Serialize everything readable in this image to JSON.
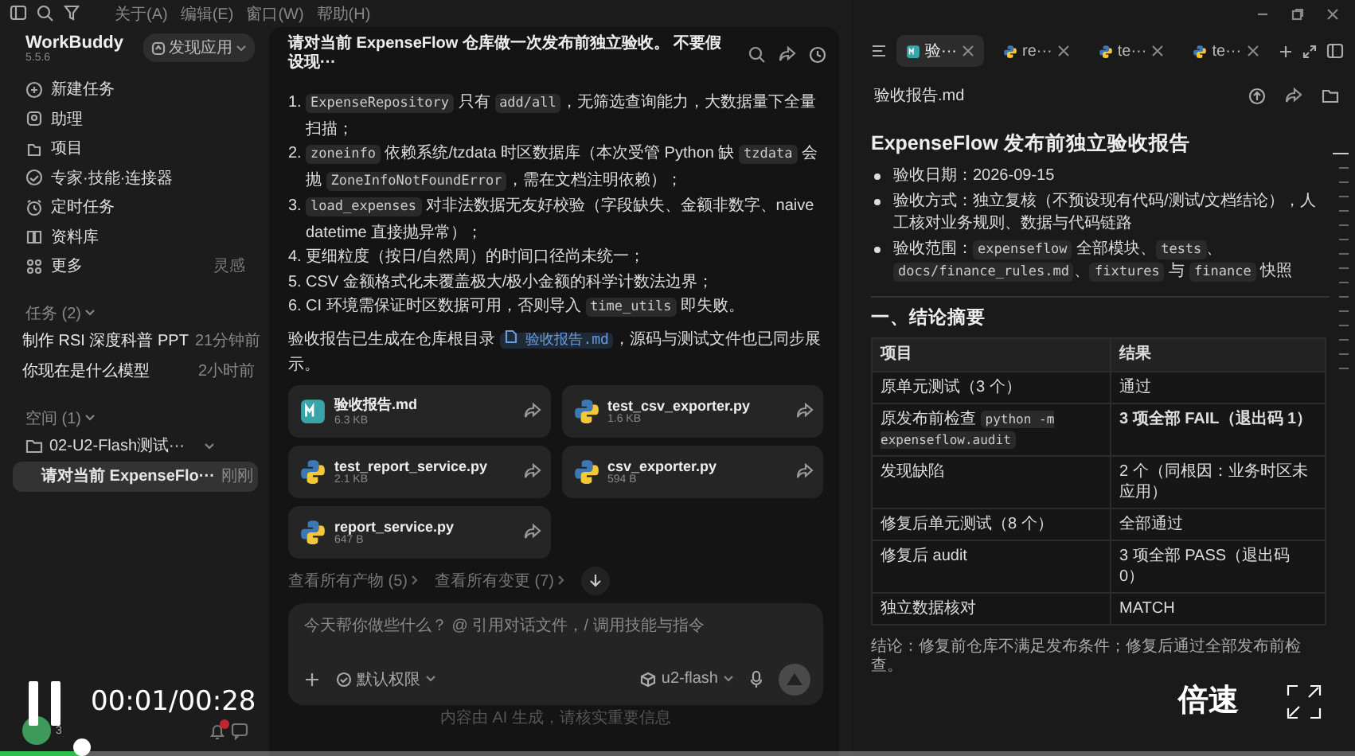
{
  "menu_bar": {
    "items": [
      "关于(A)",
      "编辑(E)",
      "窗口(W)",
      "帮助(H)"
    ]
  },
  "sidebar": {
    "app_name": "WorkBuddy",
    "version": "5.5.6",
    "discover_button": "发现应用",
    "nav": [
      {
        "label": "新建任务"
      },
      {
        "label": "助理"
      },
      {
        "label": "项目"
      },
      {
        "label": "专家·技能·连接器"
      },
      {
        "label": "定时任务"
      },
      {
        "label": "资料库"
      },
      {
        "label": "更多",
        "hint": "灵感"
      }
    ],
    "tasks_header": "任务 (2)",
    "tasks": [
      {
        "title": "制作 RSI 深度科普 PPT",
        "time": "21分钟前",
        "selected": false
      },
      {
        "title": "你现在是什么模型",
        "time": "2小时前",
        "selected": false
      }
    ],
    "spaces_header": "空间 (1)",
    "spaces": [
      {
        "name": "02-U2-Flash测试···",
        "expanded": true,
        "children": [
          {
            "title": "请对当前 ExpenseFlo···",
            "time": "刚刚",
            "selected": true
          }
        ]
      }
    ],
    "avatar_count": "3",
    "notification_dot": true
  },
  "chat": {
    "title": "请对当前 ExpenseFlow 仓库做一次发布前独立验收。 不要假设现···",
    "list": [
      {
        "number": "1.",
        "segments": [
          {
            "kind": "code",
            "text": "ExpenseRepository"
          },
          {
            "kind": "text",
            "text": " 只有 "
          },
          {
            "kind": "code",
            "text": "add/all"
          },
          {
            "kind": "text",
            "text": "，无筛选查询能力，大数据量下全量扫描；"
          }
        ]
      },
      {
        "number": "2.",
        "segments": [
          {
            "kind": "code",
            "text": "zoneinfo"
          },
          {
            "kind": "text",
            "text": " 依赖系统/tzdata 时区数据库（本次受管 Python 缺 "
          },
          {
            "kind": "code",
            "text": "tzdata"
          },
          {
            "kind": "text",
            "text": " 会抛 "
          },
          {
            "kind": "code",
            "text": "ZoneInfoNotFoundError"
          },
          {
            "kind": "text",
            "text": "，需在文档注明依赖）；"
          }
        ]
      },
      {
        "number": "3.",
        "segments": [
          {
            "kind": "code",
            "text": "load_expenses"
          },
          {
            "kind": "text",
            "text": " 对非法数据无友好校验（字段缺失、金额非数字、naive datetime 直接抛异常）；"
          }
        ]
      },
      {
        "number": "4.",
        "segments": [
          {
            "kind": "text",
            "text": "更细粒度（按日/自然周）的时间口径尚未统一；"
          }
        ]
      },
      {
        "number": "5.",
        "segments": [
          {
            "kind": "text",
            "text": "CSV 金额格式化未覆盖极大/极小金额的科学计数法边界；"
          }
        ]
      },
      {
        "number": "6.",
        "segments": [
          {
            "kind": "text",
            "text": "CI 环境需保证时区数据可用，否则导入 "
          },
          {
            "kind": "code",
            "text": "time_utils"
          },
          {
            "kind": "text",
            "text": " 即失败。"
          }
        ]
      }
    ],
    "summary": [
      {
        "kind": "text",
        "text": "验收报告已生成在仓库根目录 "
      },
      {
        "kind": "link",
        "text": "验收报告.md"
      },
      {
        "kind": "text",
        "text": "，源码与测试文件也已同步展示。"
      }
    ],
    "files": [
      {
        "name": "验收报告.md",
        "size": "6.3 KB",
        "kind": "md"
      },
      {
        "name": "test_csv_exporter.py",
        "size": "1.6 KB",
        "kind": "py"
      },
      {
        "name": "test_report_service.py",
        "size": "2.1 KB",
        "kind": "py"
      },
      {
        "name": "csv_exporter.py",
        "size": "594 B",
        "kind": "py"
      },
      {
        "name": "report_service.py",
        "size": "647 B",
        "kind": "py"
      }
    ],
    "links": [
      "查看所有产物 (5)",
      "查看所有变更 (7)"
    ],
    "composer": {
      "placeholder": "今天帮你做些什么？ @ 引用对话文件，/ 调用技能与指令",
      "permission": "默认权限",
      "model": "u2-flash"
    },
    "footnote": "内容由 AI 生成，请核实重要信息"
  },
  "preview": {
    "tabs": [
      {
        "label": "验···",
        "kind": "md",
        "selected": true
      },
      {
        "label": "re···",
        "kind": "py",
        "selected": false
      },
      {
        "label": "te···",
        "kind": "py",
        "selected": false
      },
      {
        "label": "te···",
        "kind": "py",
        "selected": false
      }
    ],
    "file_title": "验收报告.md",
    "heading": "ExpenseFlow 发布前独立验收报告",
    "bullets": [
      [
        {
          "kind": "text",
          "text": "验收日期：2026-09-15"
        }
      ],
      [
        {
          "kind": "text",
          "text": "验收方式：独立复核（不预设现有代码/测试/文档结论），人工核对业务规则、数据与代码链路"
        }
      ],
      [
        {
          "kind": "text",
          "text": "验收范围："
        },
        {
          "kind": "code",
          "text": "expenseflow"
        },
        {
          "kind": "text",
          "text": " 全部模块、"
        },
        {
          "kind": "code",
          "text": "tests"
        },
        {
          "kind": "text",
          "text": "、"
        },
        {
          "kind": "code",
          "text": "docs/finance_rules.md"
        },
        {
          "kind": "text",
          "text": "、"
        },
        {
          "kind": "code",
          "text": "fixtures"
        },
        {
          "kind": "text",
          "text": " 与 "
        },
        {
          "kind": "code",
          "text": "finance"
        },
        {
          "kind": "text",
          "text": " 快照"
        }
      ]
    ],
    "section": "一、结论摘要",
    "table": {
      "columns": [
        "项目",
        "结果"
      ],
      "rows": [
        [
          [
            {
              "kind": "text",
              "text": "原单元测试（3 个）"
            }
          ],
          [
            {
              "kind": "text",
              "text": "通过"
            }
          ]
        ],
        [
          [
            {
              "kind": "text",
              "text": "原发布前检查 "
            },
            {
              "kind": "code",
              "text": "python -m expenseflow.audit"
            }
          ],
          [
            {
              "kind": "strong",
              "text": "3 项全部 FAIL（退出码 1）"
            }
          ]
        ],
        [
          [
            {
              "kind": "text",
              "text": "发现缺陷"
            }
          ],
          [
            {
              "kind": "text",
              "text": "2 个（同根因：业务时区未应用）"
            }
          ]
        ],
        [
          [
            {
              "kind": "text",
              "text": "修复后单元测试（8 个）"
            }
          ],
          [
            {
              "kind": "text",
              "text": "全部通过"
            }
          ]
        ],
        [
          [
            {
              "kind": "text",
              "text": "修复后 audit"
            }
          ],
          [
            {
              "kind": "text",
              "text": "3 项全部 PASS（退出码 0）"
            }
          ]
        ],
        [
          [
            {
              "kind": "text",
              "text": "独立数据核对"
            }
          ],
          [
            {
              "kind": "text",
              "text": "MATCH"
            }
          ]
        ]
      ]
    },
    "conclusion": "结论：修复前仓库不满足发布条件；修复后通过全部发布前检查。"
  },
  "player": {
    "playing": true,
    "time": "00:01/00:28",
    "speed": "倍速",
    "level": 0.06
  }
}
